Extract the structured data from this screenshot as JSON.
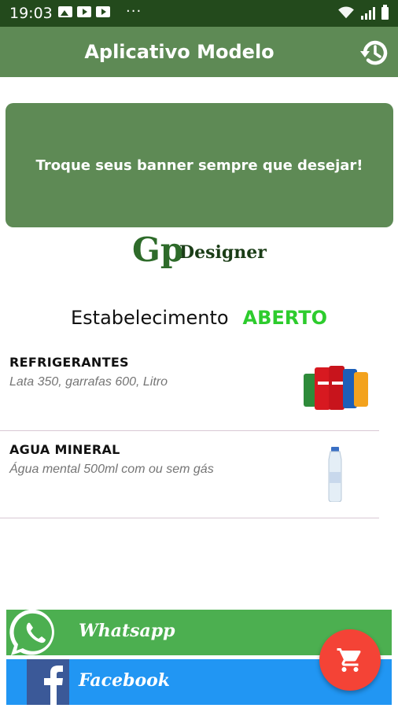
{
  "status_bar": {
    "time": "19:03",
    "dots": "···",
    "icons": [
      "image-icon",
      "youtube-icon",
      "youtube-icon",
      "wifi-icon",
      "signal-icon",
      "battery-icon"
    ]
  },
  "app_bar": {
    "title": "Aplicativo Modelo",
    "history_icon": "history-icon",
    "color": "#5e8a55"
  },
  "banner": {
    "text": "Troque seus banner sempre que desejar!"
  },
  "logo": {
    "letters": "Gp",
    "word": "Designer"
  },
  "establishment": {
    "label": "Estabelecimento",
    "status": "ABERTO",
    "status_color": "#2dcc2d"
  },
  "products": [
    {
      "name": "REFRIGERANTES",
      "description": "Lata 350, garrafas 600, Litro",
      "image": "soda-cans-image"
    },
    {
      "name": "AGUA MINERAL",
      "description": "Água mental 500ml com ou sem gás",
      "image": "water-bottle-image"
    }
  ],
  "social": {
    "whatsapp": {
      "label": "Whatsapp",
      "color": "#4caf50"
    },
    "facebook": {
      "label": "Facebook",
      "color": "#2196f3"
    }
  },
  "fab": {
    "icon": "cart-icon",
    "color": "#f44336"
  }
}
